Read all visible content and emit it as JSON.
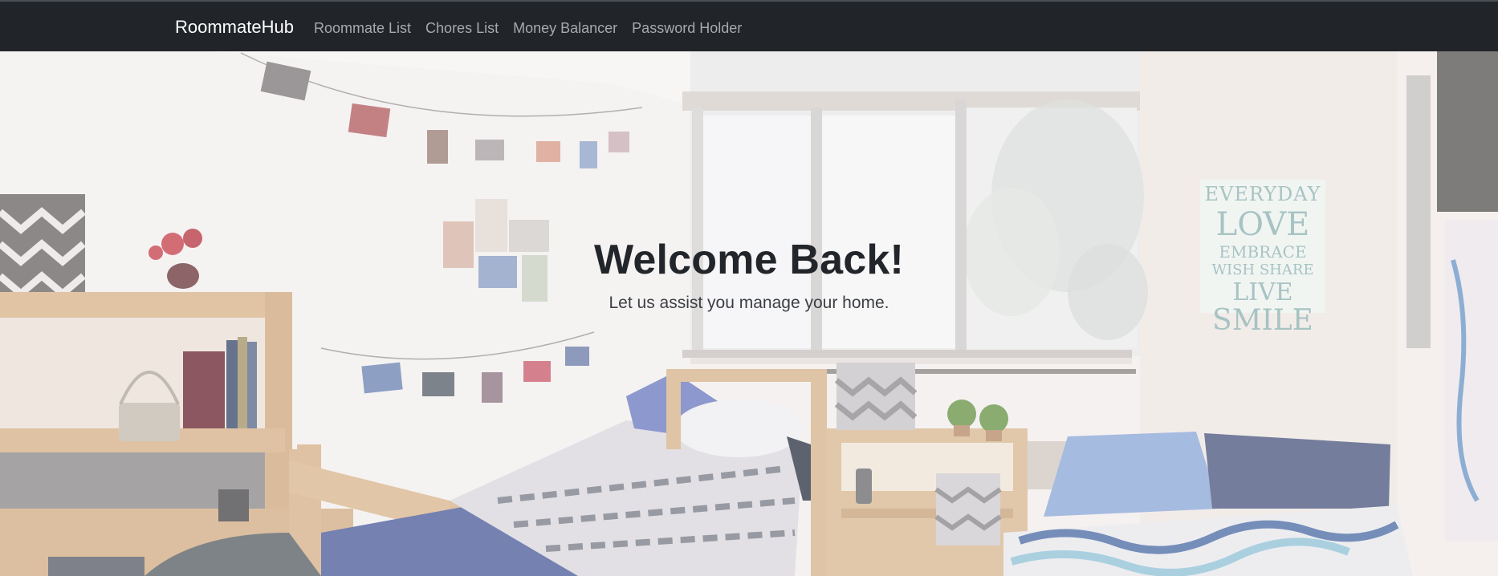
{
  "navbar": {
    "brand": "RoommateHub",
    "links": [
      {
        "label": "Roommate List"
      },
      {
        "label": "Chores List"
      },
      {
        "label": "Money Balancer"
      },
      {
        "label": "Password Holder"
      }
    ],
    "background": "#212529"
  },
  "hero": {
    "title": "Welcome Back!",
    "subtitle": "Let us assist you manage your home.",
    "background_image": "dorm-room-photo",
    "poster": {
      "lines": [
        "EVERYDAY",
        "LOVE",
        "EMBRACE",
        "WISH SHARE",
        "LIVE",
        "SMILE"
      ]
    }
  }
}
